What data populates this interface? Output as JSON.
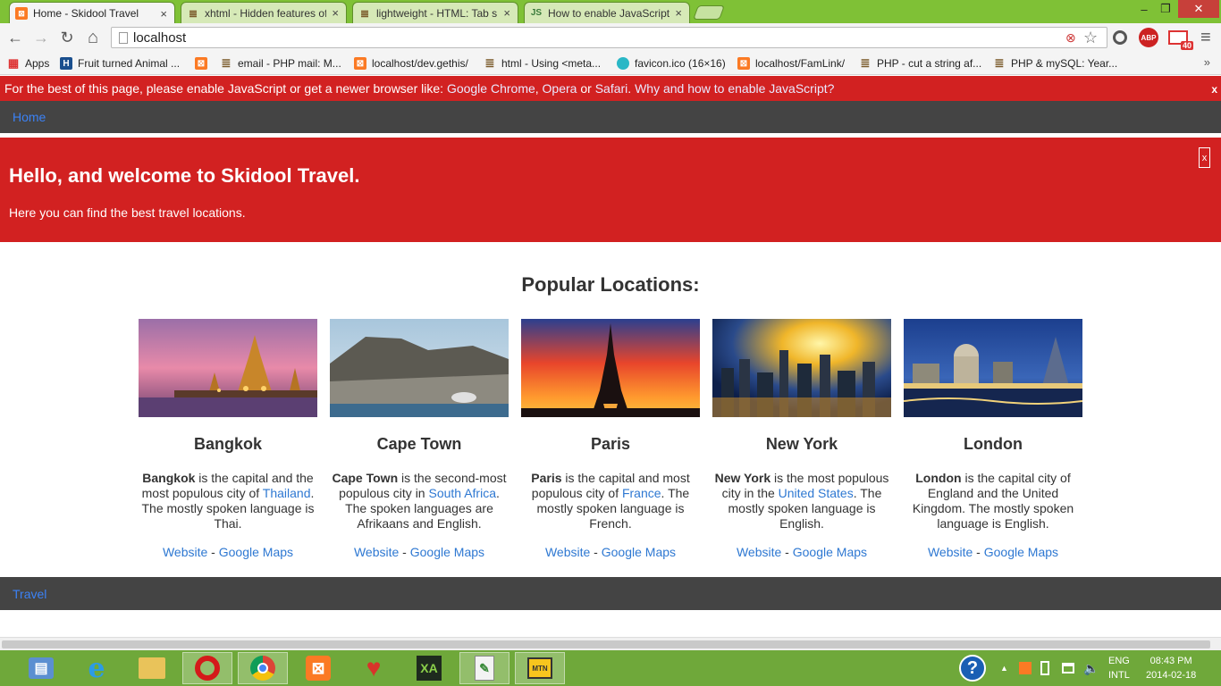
{
  "browser": {
    "tabs": [
      {
        "title": "Home - Skidool Travel",
        "icon": "xampp-icon",
        "active": true
      },
      {
        "title": "xhtml - Hidden features of",
        "icon": "stackoverflow-icon",
        "active": false
      },
      {
        "title": "lightweight - HTML: Tab s",
        "icon": "stackoverflow-icon",
        "active": false
      },
      {
        "title": "How to enable JavaScript i",
        "icon": "js-icon",
        "active": false
      }
    ],
    "tab_close": "×",
    "window_controls": {
      "minimize": "–",
      "maximize": "❐",
      "close": "✕"
    },
    "nav": {
      "back": "←",
      "forward": "→",
      "reload": "↻",
      "home": "⌂"
    },
    "address": "localhost",
    "star": "☆",
    "gmail_count": "40",
    "abp_label": "ABP",
    "menu": "≡",
    "bookmarks": [
      {
        "label": "Apps",
        "icon": "apps-icon"
      },
      {
        "label": "Fruit turned Animal ...",
        "icon": "h-icon"
      },
      {
        "label": "",
        "icon": "xampp-icon"
      },
      {
        "label": "email - PHP mail: M...",
        "icon": "stackoverflow-icon"
      },
      {
        "label": "localhost/dev.gethis/",
        "icon": "xampp-icon"
      },
      {
        "label": "html - Using <meta...",
        "icon": "stackoverflow-icon"
      },
      {
        "label": "favicon.ico (16×16)",
        "icon": "favicon-icon"
      },
      {
        "label": "localhost/FamLink/",
        "icon": "xampp-icon"
      },
      {
        "label": "PHP - cut a string af...",
        "icon": "stackoverflow-icon"
      },
      {
        "label": "PHP & mySQL: Year...",
        "icon": "stackoverflow-icon"
      }
    ],
    "bookmarks_more": "»"
  },
  "page": {
    "nojs": {
      "text_before": "For the best of this page, please enable JavaScript or get a newer browser like: ",
      "chrome": "Google Chrome",
      "sep1": ", ",
      "opera": "Opera",
      "or": " or ",
      "safari": "Safari",
      "dot": ". ",
      "why": "Why and how to enable JavaScript?",
      "close": "x"
    },
    "nav_home": "Home",
    "hero": {
      "title": "Hello, and welcome to Skidool Travel.",
      "subtitle": "Here you can find the best travel locations.",
      "close": "x"
    },
    "section_title": "Popular Locations:",
    "locations": [
      {
        "name": "Bangkok",
        "bold": "Bangkok",
        "t1": " is the capital and the most populous city of ",
        "link": "Thailand",
        "t2": ". The mostly spoken language is Thai.",
        "website": "Website",
        "sep": " - ",
        "maps": "Google Maps"
      },
      {
        "name": "Cape Town",
        "bold": "Cape Town",
        "t1": " is the second-most populous city in ",
        "link": "South Africa",
        "t2": ". The spoken languages are Afrikaans and English.",
        "website": "Website",
        "sep": " - ",
        "maps": "Google Maps"
      },
      {
        "name": "Paris",
        "bold": "Paris",
        "t1": " is the capital and most populous city of ",
        "link": "France",
        "t2": ". The mostly spoken language is French.",
        "website": "Website",
        "sep": " - ",
        "maps": "Google Maps"
      },
      {
        "name": "New York",
        "bold": "New York",
        "t1": " is the most populous city in the ",
        "link": "United States",
        "t2": ". The mostly spoken language is English.",
        "website": "Website",
        "sep": " - ",
        "maps": "Google Maps"
      },
      {
        "name": "London",
        "bold": "London",
        "t1": " is the capital city of England and the United Kingdom. The mostly spoken language is English.",
        "link": "",
        "t2": "",
        "website": "Website",
        "sep": " - ",
        "maps": "Google Maps"
      }
    ],
    "footer_link": "Travel"
  },
  "taskbar": {
    "apps": [
      "control-panel-icon",
      "internet-explorer-icon",
      "file-explorer-icon",
      "opera-icon",
      "chrome-icon",
      "xampp-icon",
      "heart-app-icon",
      "code-editor-icon",
      "notepad-icon",
      "mtn-modem-icon"
    ],
    "help": "?",
    "tray_arrow": "▲",
    "lang_top": "ENG",
    "lang_bottom": "INTL",
    "time": "08:43 PM",
    "date": "2014-02-18"
  },
  "colors": {
    "red": "#d22121",
    "dark": "#444444",
    "link": "#2e78d2",
    "chrome_green": "#7fc136"
  }
}
